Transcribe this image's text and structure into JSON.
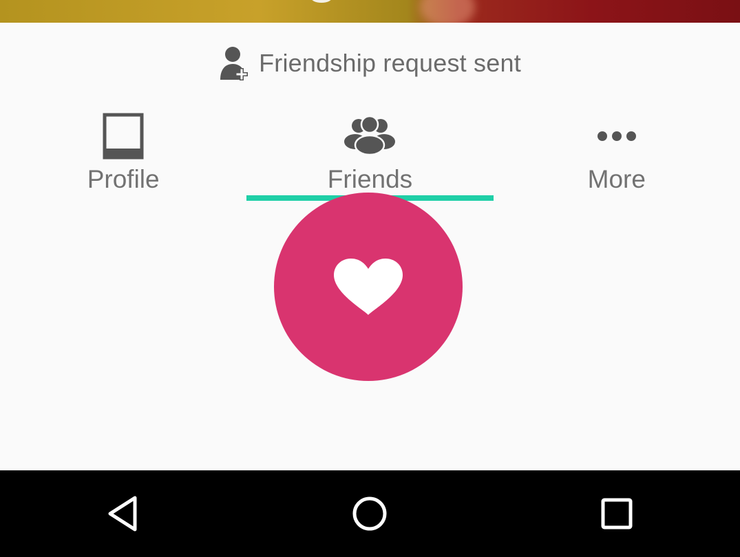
{
  "status": {
    "icon": "add-friend-icon",
    "text": "Friendship request sent"
  },
  "tabs": [
    {
      "label": "Profile",
      "icon": "profile-frame-icon",
      "selected": false
    },
    {
      "label": "Friends",
      "icon": "friends-group-icon",
      "selected": true
    },
    {
      "label": "More",
      "icon": "more-dots-icon",
      "selected": false
    }
  ],
  "fab": {
    "icon": "heart-icon"
  },
  "navbar": {
    "buttons": [
      {
        "icon": "back-triangle-icon"
      },
      {
        "icon": "home-circle-icon"
      },
      {
        "icon": "recents-square-icon"
      }
    ]
  },
  "colors": {
    "accent_indicator": "#1fcfa7",
    "fab": "#d9346f",
    "text_gray": "#6b6b6b",
    "icon_gray": "#555555",
    "navbar": "#000000"
  }
}
